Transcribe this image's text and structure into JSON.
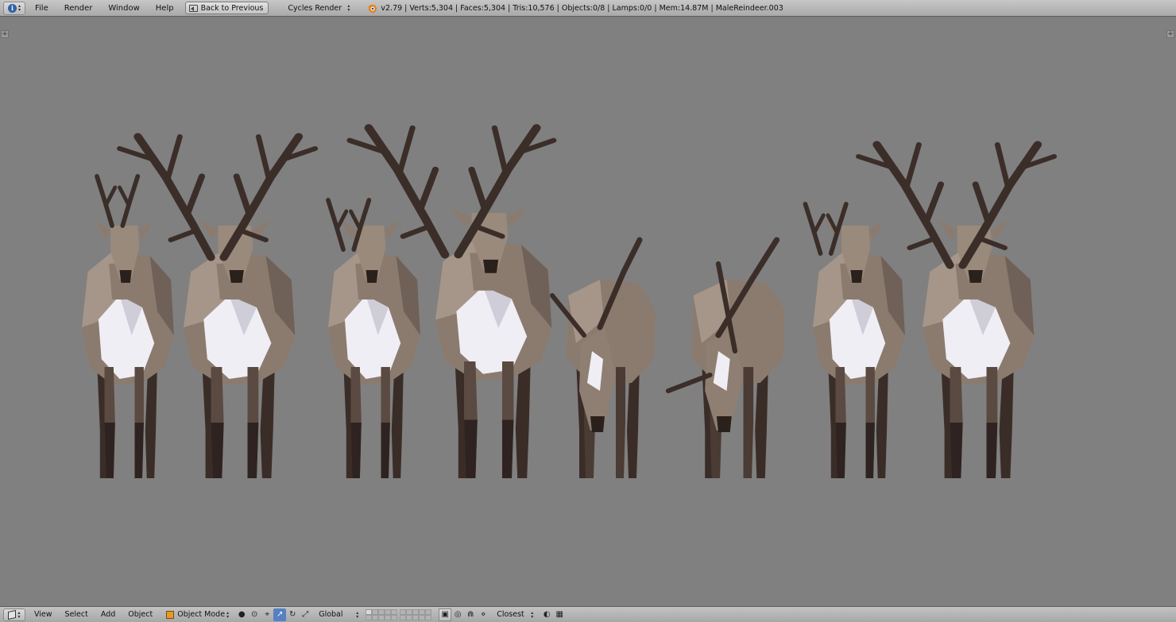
{
  "top_bar": {
    "editor_icon": "info-icon",
    "menus": [
      "File",
      "Render",
      "Window",
      "Help"
    ],
    "back_button": "Back to Previous",
    "render_engine": "Cycles Render",
    "stats": "v2.79 | Verts:5,304 | Faces:5,304 | Tris:10,576 | Objects:0/8 | Lamps:0/0 | Mem:14.87M | MaleReindeer.003"
  },
  "viewport": {
    "background": "#808080",
    "content": "8 low-poly reindeer models",
    "colors": {
      "fur": "#8b7b6f",
      "fur_light": "#a59689",
      "belly": "#efeef4",
      "legs": "#3a2d28",
      "antler": "#3b2e29"
    }
  },
  "bottom_bar": {
    "editor_icon": "3d-view-icon",
    "menus": [
      "View",
      "Select",
      "Add",
      "Object"
    ],
    "mode": "Object Mode",
    "orientation": "Global",
    "snap_target": "Closest"
  }
}
